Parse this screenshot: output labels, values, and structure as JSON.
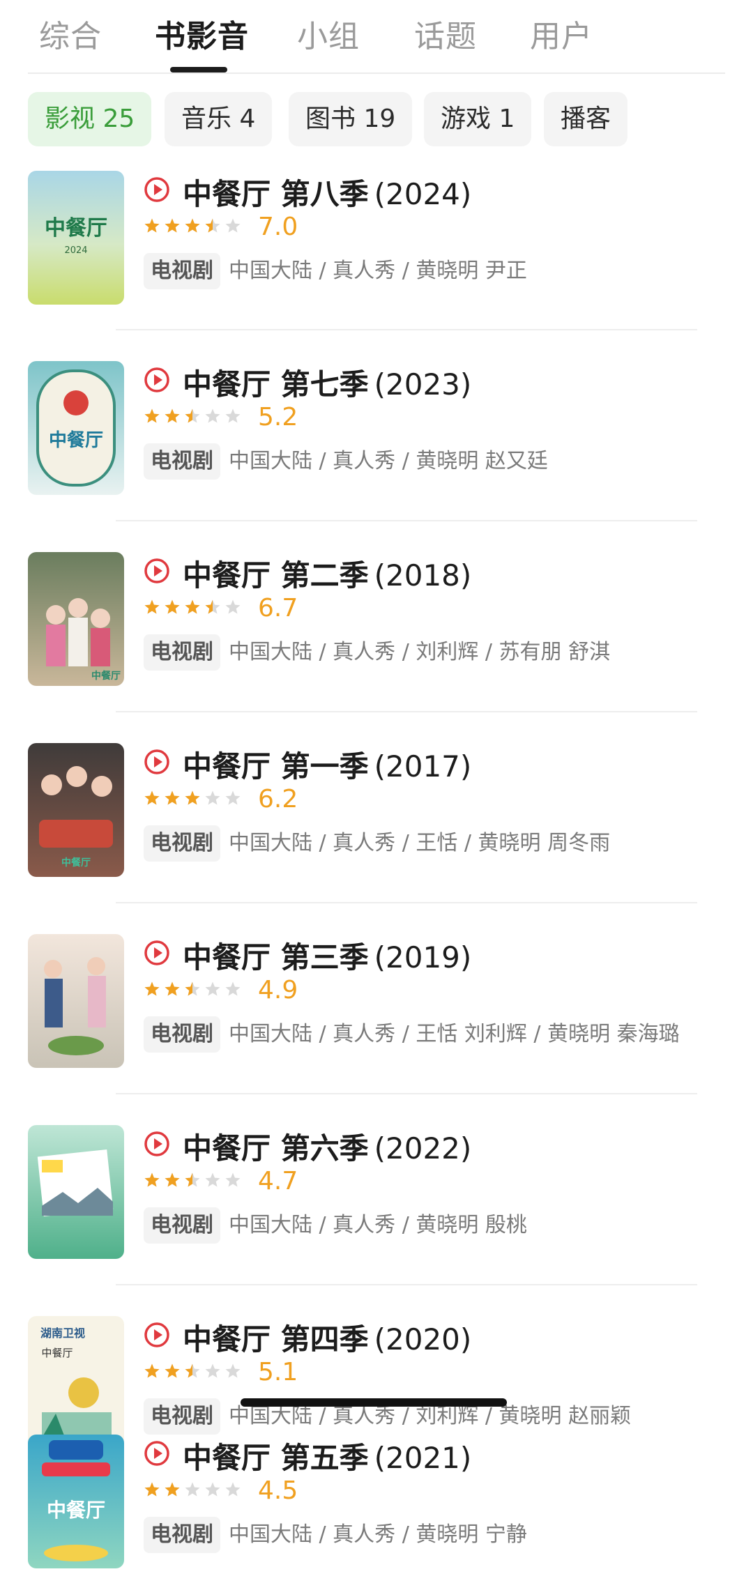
{
  "tabs": [
    {
      "label": "综合",
      "active": false
    },
    {
      "label": "书影音",
      "active": true
    },
    {
      "label": "小组",
      "active": false
    },
    {
      "label": "话题",
      "active": false
    },
    {
      "label": "用户",
      "active": false
    }
  ],
  "filters": [
    {
      "label": "影视 25",
      "active": true
    },
    {
      "label": "音乐 4",
      "active": false
    },
    {
      "label": "图书 19",
      "active": false
    },
    {
      "label": "游戏 1",
      "active": false
    },
    {
      "label": "播客",
      "active": false
    }
  ],
  "colors": {
    "accent_green": "#3a9d3a",
    "star": "#f0a020",
    "star_empty": "#d9d9d9",
    "play": "#e0393e"
  },
  "items": [
    {
      "title": "中餐厅 第八季",
      "year": "(2024)",
      "stars": 3.5,
      "score": "7.0",
      "tag": "电视剧",
      "meta": "中国大陆 / 真人秀 / 黄晓明 尹正"
    },
    {
      "title": "中餐厅 第七季",
      "year": "(2023)",
      "stars": 2.5,
      "score": "5.2",
      "tag": "电视剧",
      "meta": "中国大陆 / 真人秀 / 黄晓明 赵又廷"
    },
    {
      "title": "中餐厅 第二季",
      "year": "(2018)",
      "stars": 3.5,
      "score": "6.7",
      "tag": "电视剧",
      "meta": "中国大陆 / 真人秀 / 刘利辉 / 苏有朋 舒淇"
    },
    {
      "title": "中餐厅 第一季",
      "year": "(2017)",
      "stars": 3,
      "score": "6.2",
      "tag": "电视剧",
      "meta": "中国大陆 / 真人秀 / 王恬 / 黄晓明 周冬雨"
    },
    {
      "title": "中餐厅 第三季",
      "year": "(2019)",
      "stars": 2.5,
      "score": "4.9",
      "tag": "电视剧",
      "meta": "中国大陆 / 真人秀 / 王恬 刘利辉 / 黄晓明 秦海璐"
    },
    {
      "title": "中餐厅 第六季",
      "year": "(2022)",
      "stars": 2.5,
      "score": "4.7",
      "tag": "电视剧",
      "meta": "中国大陆 / 真人秀 / 黄晓明 殷桃"
    },
    {
      "title": "中餐厅 第四季",
      "year": "(2020)",
      "stars": 2.5,
      "score": "5.1",
      "tag": "电视剧",
      "meta": "中国大陆 / 真人秀 / 刘利辉 / 黄晓明 赵丽颖"
    },
    {
      "title": "中餐厅 第五季",
      "year": "(2021)",
      "stars": 2,
      "score": "4.5",
      "tag": "电视剧",
      "meta": "中国大陆 / 真人秀 / 黄晓明 宁静"
    }
  ],
  "posters": [
    {
      "logo": "中餐厅",
      "sub": "2024"
    },
    {
      "logo": "中餐厅",
      "sub": ""
    },
    {
      "logo": "中餐厅",
      "sub": ""
    },
    {
      "logo": "中餐厅",
      "sub": ""
    },
    {
      "logo": "",
      "sub": ""
    },
    {
      "logo": "",
      "sub": ""
    },
    {
      "logo": "中餐厅",
      "sub": "湖南卫视"
    },
    {
      "logo": "中餐厅",
      "sub": ""
    }
  ]
}
